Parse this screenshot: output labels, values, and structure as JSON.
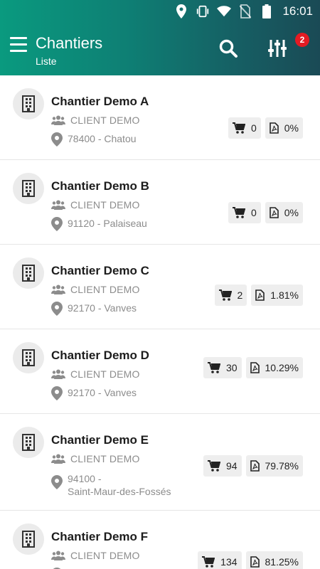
{
  "status": {
    "time": "16:01"
  },
  "appbar": {
    "title": "Chantiers",
    "subtitle": "Liste",
    "filter_badge": "2"
  },
  "items": [
    {
      "name": "Chantier Demo A",
      "client": "CLIENT DEMO",
      "address": "78400 - Chatou",
      "orders": "0",
      "progress": "0%"
    },
    {
      "name": "Chantier Demo B",
      "client": "CLIENT DEMO",
      "address": "91120 - Palaiseau",
      "orders": "0",
      "progress": "0%"
    },
    {
      "name": "Chantier Demo C",
      "client": "CLIENT DEMO",
      "address": "92170 - Vanves",
      "orders": "2",
      "progress": "1.81%"
    },
    {
      "name": "Chantier Demo D",
      "client": "CLIENT DEMO",
      "address": "92170 - Vanves",
      "orders": "30",
      "progress": "10.29%"
    },
    {
      "name": "Chantier Demo E",
      "client": "CLIENT DEMO",
      "address_line1": "94100 -",
      "address_line2": "Saint-Maur-des-Fossés",
      "orders": "94",
      "progress": "79.78%"
    },
    {
      "name": "Chantier Demo F",
      "client": "CLIENT DEMO",
      "address": "",
      "orders": "134",
      "progress": "81.25%"
    }
  ]
}
